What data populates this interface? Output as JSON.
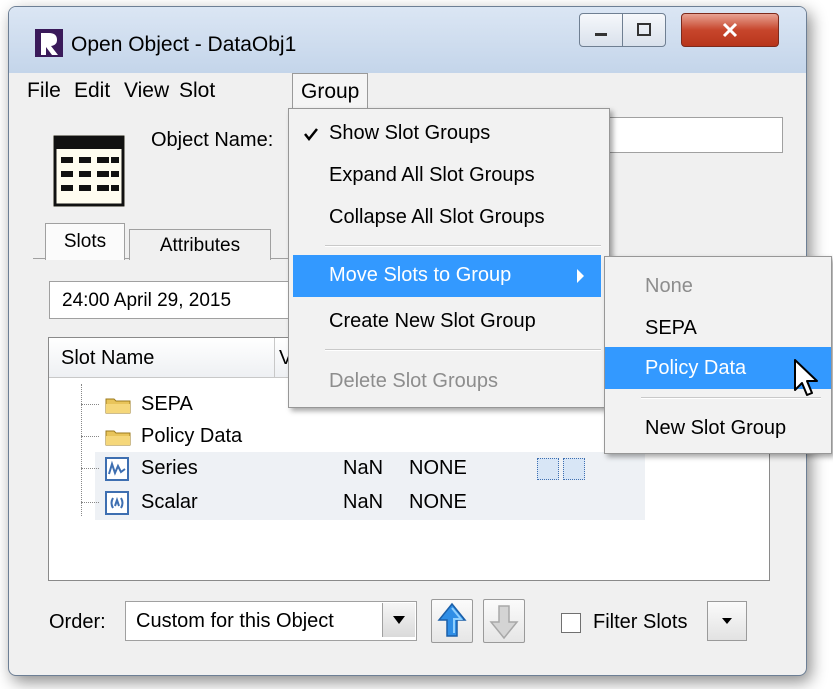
{
  "window": {
    "title": "Open Object - DataObj1",
    "controls": {
      "minimize": "minimize",
      "maximize": "maximize",
      "close": "close"
    }
  },
  "menubar": {
    "items": [
      "File",
      "Edit",
      "View",
      "Slot",
      "Group"
    ],
    "open_menu": "Group"
  },
  "group_menu": {
    "items": [
      {
        "label": "Show Slot Groups",
        "checked": true,
        "enabled": true
      },
      {
        "label": "Expand All Slot Groups",
        "enabled": true
      },
      {
        "label": "Collapse All Slot Groups",
        "enabled": true
      },
      {
        "label": "Move Slots to Group",
        "enabled": true,
        "highlighted": true,
        "has_submenu": true
      },
      {
        "label": "Create New Slot Group",
        "enabled": true
      },
      {
        "label": "Delete Slot Groups",
        "enabled": false
      }
    ]
  },
  "submenu": {
    "items": [
      {
        "label": "None",
        "enabled": false
      },
      {
        "label": "SEPA",
        "enabled": true
      },
      {
        "label": "Policy Data",
        "enabled": true,
        "highlighted": true
      },
      {
        "label": "New Slot Group",
        "enabled": true
      }
    ]
  },
  "object": {
    "name_label": "Object Name:",
    "name_value": ""
  },
  "tabs": [
    {
      "label": "Slots",
      "active": true
    },
    {
      "label": "Attributes",
      "active": false
    }
  ],
  "timestep": {
    "value": "24:00 April 29, 2015"
  },
  "slot_table": {
    "columns": [
      "Slot Name",
      "V"
    ],
    "groups": [
      {
        "name": "SEPA"
      },
      {
        "name": "Policy Data"
      }
    ],
    "slots": [
      {
        "name": "Series",
        "icon": "series-slot-icon",
        "value": "NaN",
        "units": "NONE"
      },
      {
        "name": "Scalar",
        "icon": "scalar-slot-icon",
        "value": "NaN",
        "units": "NONE"
      }
    ]
  },
  "footer": {
    "order_label": "Order:",
    "order_value": "Custom for this Object",
    "filter_label": "Filter Slots",
    "filter_checked": false
  },
  "colors": {
    "highlight": "#3399ff",
    "window_bg": "#f0f0f0",
    "close_red": "#c7462c",
    "slot_icon_blue": "#3e6fb1"
  }
}
